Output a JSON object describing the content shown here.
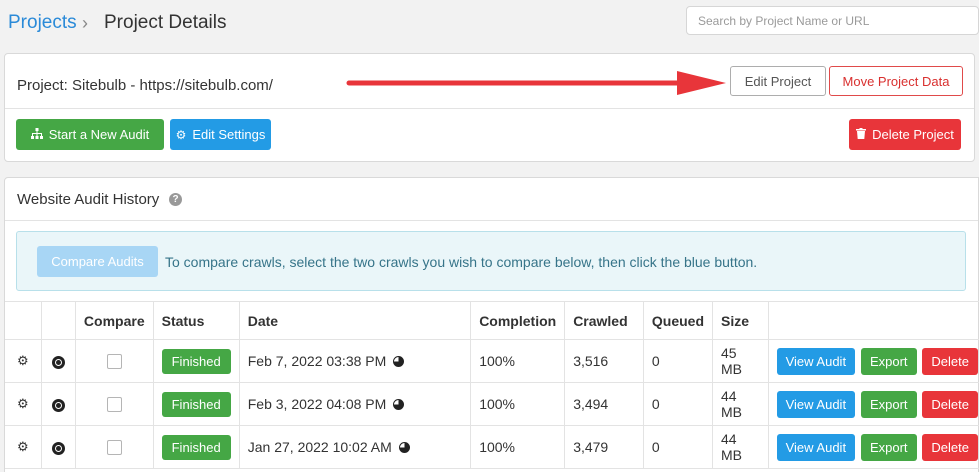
{
  "breadcrumb": {
    "parent": "Projects",
    "separator": "›",
    "current": "Project Details"
  },
  "search": {
    "placeholder": "Search by Project Name or URL",
    "value": ""
  },
  "project": {
    "title": "Project: Sitebulb - https://sitebulb.com/",
    "edit_label": "Edit Project",
    "move_label": "Move Project Data",
    "start_audit_label": "Start a New Audit",
    "edit_settings_label": "Edit Settings",
    "delete_label": "Delete Project"
  },
  "history": {
    "title": "Website Audit History",
    "help_icon": "?",
    "compare_button": "Compare Audits",
    "compare_hint": "To compare crawls, select the two crawls you wish to compare below, then click the blue button.",
    "columns": [
      "",
      "",
      "Compare",
      "Status",
      "Date",
      "Completion",
      "Crawled",
      "Queued",
      "Size",
      ""
    ],
    "rows": [
      {
        "status": "Finished",
        "date": "Feb 7, 2022 03:38 PM",
        "completion": "100%",
        "crawled": "3,516",
        "queued": "0",
        "size": "45 MB"
      },
      {
        "status": "Finished",
        "date": "Feb 3, 2022 04:08 PM",
        "completion": "100%",
        "crawled": "3,494",
        "queued": "0",
        "size": "44 MB"
      },
      {
        "status": "Finished",
        "date": "Jan 27, 2022 10:02 AM",
        "completion": "100%",
        "crawled": "3,479",
        "queued": "0",
        "size": "44 MB"
      }
    ],
    "row_actions": {
      "view": "View Audit",
      "export": "Export",
      "delete": "Delete"
    }
  },
  "colors": {
    "link": "#2a8ad8",
    "green": "#45a745",
    "blue": "#239be5",
    "red": "#e8353a",
    "arrow": "#e8353a"
  },
  "icons": {
    "start_audit": "sitemap-icon",
    "edit_settings": "gears-icon",
    "delete_project": "trash-icon",
    "row_settings": "gears-icon",
    "row_browser": "chrome-icon",
    "date_chart": "pie-chart-icon",
    "help": "question-circle-icon"
  }
}
